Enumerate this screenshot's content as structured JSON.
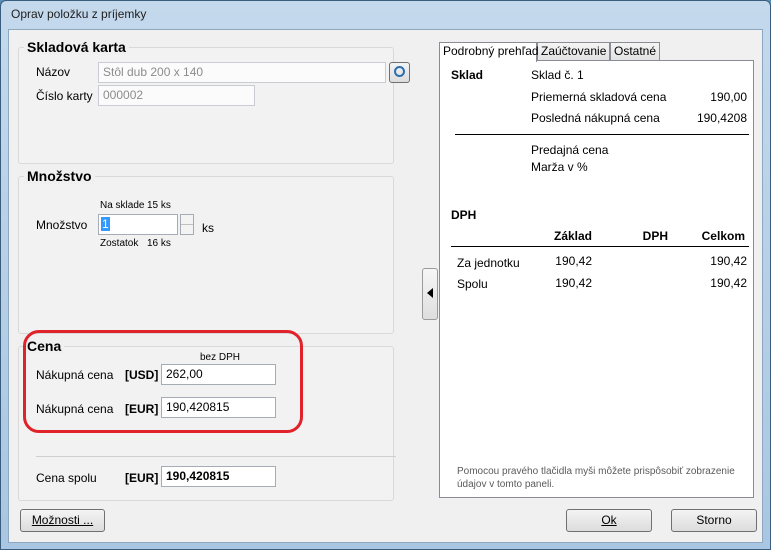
{
  "window": {
    "title": "Oprav položku z príjemky"
  },
  "skladova_karta": {
    "title": "Skladová karta",
    "nazov_label": "Názov",
    "nazov_value": "Stôl dub 200 x 140",
    "cislo_label": "Číslo karty",
    "cislo_value": "000002"
  },
  "mnozstvo": {
    "title": "Množstvo",
    "na_sklade_label": "Na sklade",
    "na_sklade_value": "15 ks",
    "mnozstvo_label": "Množstvo",
    "mnozstvo_value": "1",
    "unit": "ks",
    "zostatok_label": "Zostatok",
    "zostatok_value": "16 ks"
  },
  "cena": {
    "title": "Cena",
    "bez_dph": "bez DPH",
    "rows": [
      {
        "label": "Nákupná cena",
        "currency": "[USD]",
        "value": "262,00"
      },
      {
        "label": "Nákupná cena",
        "currency": "[EUR]",
        "value": "190,420815"
      }
    ],
    "spolu_label": "Cena spolu",
    "spolu_currency": "[EUR]",
    "spolu_value": "190,420815"
  },
  "buttons": {
    "moznosti": "Možnosti ...",
    "ok": "Ok",
    "storno": "Storno"
  },
  "tabs": [
    {
      "label": "Podrobný prehľad"
    },
    {
      "label": "Zaúčtovanie"
    },
    {
      "label": "Ostatné"
    }
  ],
  "detail": {
    "sklad_label": "Sklad",
    "sklad_value": "Sklad č. 1",
    "priemerna_label": "Priemerná skladová cena",
    "priemerna_value": "190,00",
    "posledna_label": "Posledná nákupná cena",
    "posledna_value": "190,4208",
    "predajna_label": "Predajná cena",
    "marza_label": "Marža v %",
    "dph_title": "DPH",
    "columns": [
      "Základ",
      "DPH",
      "Celkom"
    ],
    "rows": [
      {
        "label": "Za jednotku",
        "zaklad": "190,42",
        "dph": "",
        "celkom": "190,42"
      },
      {
        "label": "Spolu",
        "zaklad": "190,42",
        "dph": "",
        "celkom": "190,42"
      }
    ],
    "hint": "Pomocou pravého tlačidla myši môžete prispôsobiť zobrazenie údajov v tomto paneli."
  }
}
